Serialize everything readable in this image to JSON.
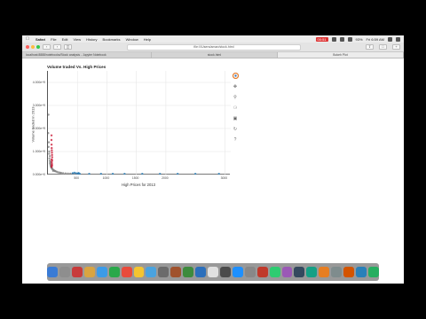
{
  "menubar": {
    "app": "Safari",
    "items": [
      "File",
      "Edit",
      "View",
      "History",
      "Bookmarks",
      "Window",
      "Help"
    ],
    "recording": "00:51",
    "battery": "93%",
    "clock": "Fri 6:59 AM"
  },
  "browser": {
    "url": "file:///Users/aman/stock.html",
    "tabs": [
      "localhost:8888/notebooks/Stock analysis - Jupyter Notebook",
      "stock.html",
      "Bokeh Plot"
    ]
  },
  "chart_data": {
    "type": "scatter",
    "title": "Volume traded Vs. High Prices",
    "xlabel": "High Prices for 2013",
    "ylabel": "Volume traded in 2013",
    "xlim": [
      0,
      3100
    ],
    "ylim": [
      0,
      4500000000
    ],
    "xticks": [
      "500",
      "1000",
      "1500",
      "2000",
      "3000"
    ],
    "xtick_values": [
      500,
      1000,
      1500,
      2000,
      3000
    ],
    "yticks": [
      "0.000e+0",
      "1.000e+9",
      "2.000e+9",
      "3.000e+9",
      "4.000e+9"
    ],
    "ytick_values": [
      0,
      1000000000,
      2000000000,
      3000000000,
      4000000000
    ],
    "grid": true,
    "series": [
      {
        "color": "#808080",
        "x": [
          5,
          10,
          15,
          20,
          25,
          30,
          35,
          40,
          45,
          50,
          55,
          60,
          70,
          80,
          90,
          100,
          110,
          120,
          130,
          150,
          170,
          190,
          210,
          230,
          260,
          300,
          340,
          380,
          420,
          460,
          500,
          12,
          22,
          33,
          44,
          66,
          88
        ],
        "y": [
          1800000000,
          2600000000,
          1400000000,
          900000000,
          700000000,
          600000000,
          500000000,
          450000000,
          400000000,
          350000000,
          320000000,
          300000000,
          250000000,
          230000000,
          200000000,
          180000000,
          170000000,
          150000000,
          140000000,
          120000000,
          100000000,
          90000000,
          80000000,
          70000000,
          60000000,
          50000000,
          45000000,
          40000000,
          35000000,
          30000000,
          25000000,
          1200000000,
          1000000000,
          800000000,
          550000000,
          280000000,
          160000000
        ]
      },
      {
        "color": "#c8102e",
        "x": [
          60,
          62,
          64,
          66,
          68,
          70,
          72,
          63,
          65,
          67,
          69,
          61,
          71,
          66,
          64
        ],
        "y": [
          1500000000,
          1300000000,
          1150000000,
          1050000000,
          950000000,
          850000000,
          750000000,
          650000000,
          550000000,
          480000000,
          420000000,
          1700000000,
          620000000,
          380000000,
          330000000
        ]
      },
      {
        "color": "#1f77b4",
        "x": [
          420,
          450,
          480,
          510,
          520,
          540,
          700,
          900,
          1100,
          1300,
          1600,
          1900,
          2200,
          2500,
          2900
        ],
        "y": [
          60000000,
          80000000,
          55000000,
          40000000,
          70000000,
          30000000,
          20000000,
          15000000,
          12000000,
          10000000,
          8000000,
          6000000,
          5000000,
          4000000,
          3000000
        ]
      }
    ]
  },
  "bokeh_tools": [
    "bokeh-logo-icon",
    "pan-icon",
    "zoom-icon",
    "wheel-zoom-icon",
    "save-icon",
    "reset-icon",
    "help-icon"
  ],
  "dock": {
    "icon_colors": [
      "#3a7bd5",
      "#8e8e8e",
      "#c83b3b",
      "#d9a441",
      "#3c9be8",
      "#2aa84a",
      "#e84b3c",
      "#f4c430",
      "#4aa3df",
      "#6b6b6b",
      "#a0522d",
      "#3d8b3d",
      "#2c6fbb",
      "#e0e0e0",
      "#4b4b4b",
      "#1e90ff",
      "#888888",
      "#c0392b",
      "#2ecc71",
      "#9b59b6",
      "#34495e",
      "#16a085",
      "#e67e22",
      "#7f8c8d",
      "#d35400",
      "#2980b9",
      "#27ae60"
    ]
  }
}
